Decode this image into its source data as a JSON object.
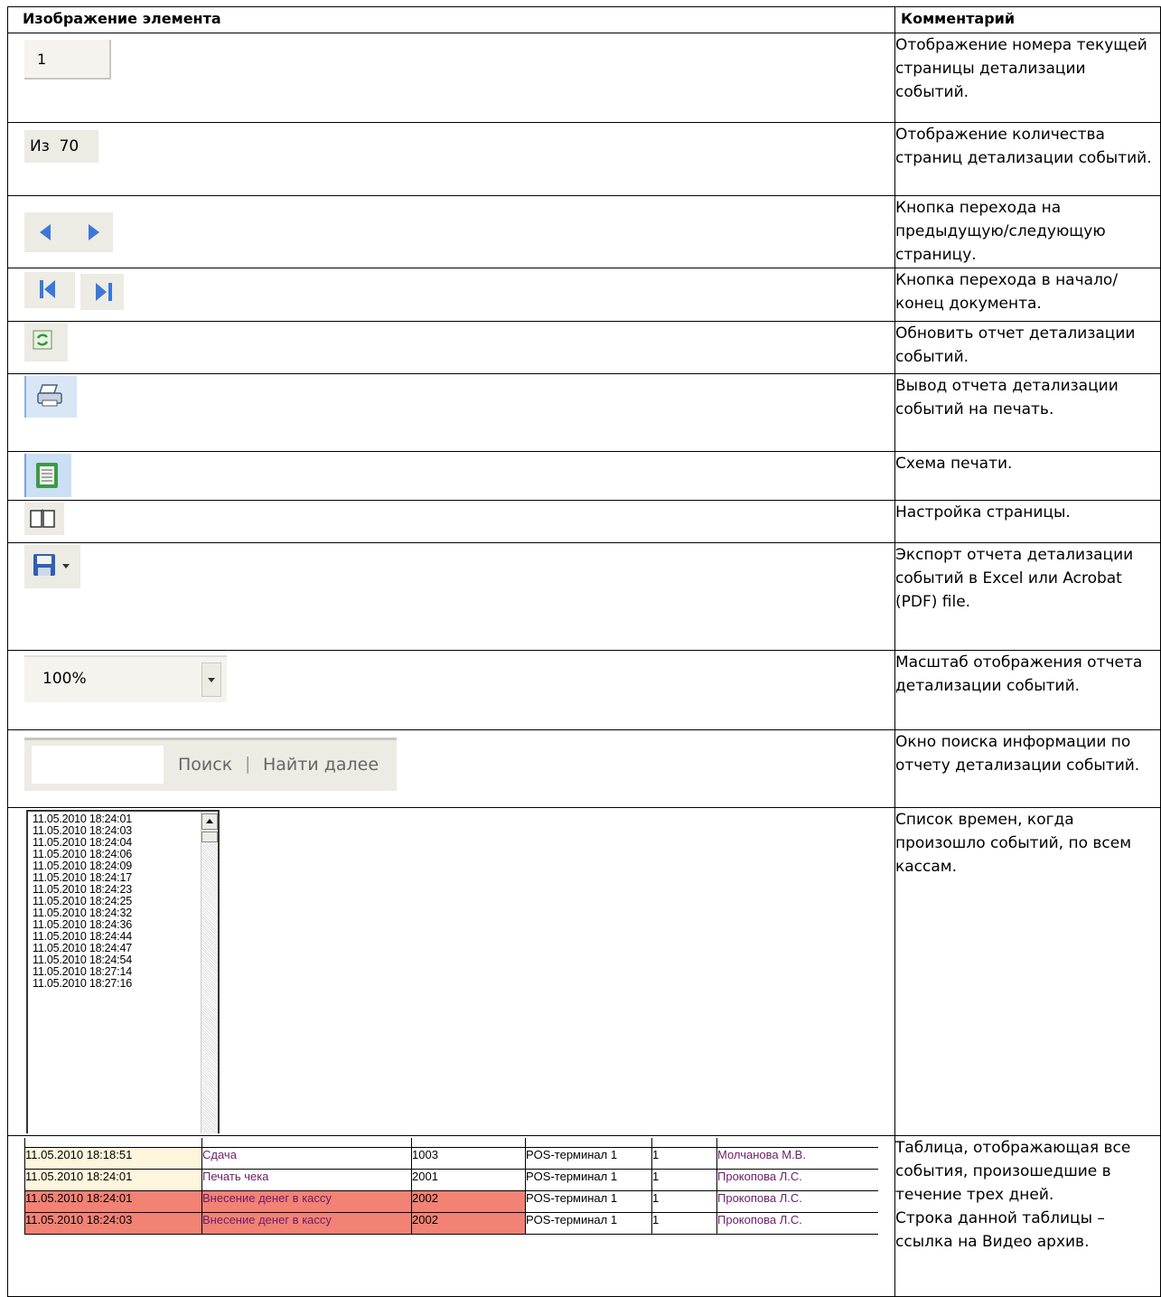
{
  "header": {
    "col_image": "Изображение элемента",
    "col_comment": "Комментарий"
  },
  "rows": [
    {
      "image": {
        "page_number": "1"
      },
      "comment": "Отображение номера текущей страницы детализации событий."
    },
    {
      "image": {
        "of_label": "Из",
        "of_value": "70"
      },
      "comment": "Отображение количества страниц  детализации событий."
    },
    {
      "image": {
        "icons": [
          "prev-page-icon",
          "next-page-icon"
        ]
      },
      "comment": "Кнопка перехода на предыдущую/следующую страницу."
    },
    {
      "image": {
        "icons": [
          "first-page-icon",
          "last-page-icon"
        ]
      },
      "comment": "Кнопка перехода в начало/конец документа."
    },
    {
      "image": {
        "icons": [
          "refresh-icon"
        ]
      },
      "comment": "Обновить отчет детализации событий."
    },
    {
      "image": {
        "icons": [
          "print-icon"
        ]
      },
      "comment": "Вывод отчета детализации событий на печать."
    },
    {
      "image": {
        "icons": [
          "print-layout-icon"
        ]
      },
      "comment": "Схема печати."
    },
    {
      "image": {
        "icons": [
          "page-setup-icon"
        ]
      },
      "comment": "Настройка страницы."
    },
    {
      "image": {
        "icons": [
          "save-export-icon",
          "dropdown-arrow-icon"
        ]
      },
      "comment": "Экспорт отчета детализации событий в Excel или Acrobat (PDF) file."
    },
    {
      "image": {
        "zoom_value": "100%"
      },
      "comment": "Масштаб отображения отчета детализации событий."
    },
    {
      "image": {
        "search_label": "Поиск",
        "separator": "|",
        "find_next_label": "Найти далее"
      },
      "comment": "Окно поиска информации по отчету детализации событий."
    },
    {
      "image": {
        "times": [
          "11.05.2010 18:24:01",
          "11.05.2010 18:24:03",
          "11.05.2010 18:24:04",
          "11.05.2010 18:24:06",
          "11.05.2010 18:24:09",
          "11.05.2010 18:24:17",
          "11.05.2010 18:24:23",
          "11.05.2010 18:24:25",
          "11.05.2010 18:24:32",
          "11.05.2010 18:24:36",
          "11.05.2010 18:24:44",
          "11.05.2010 18:24:47",
          "11.05.2010 18:24:54",
          "11.05.2010 18:27:14",
          "11.05.2010 18:27:16"
        ]
      },
      "comment": "Список времен, когда произошло событий, по всем кассам."
    },
    {
      "image": {
        "events": [
          {
            "date": "11.05.2010 18:18:51",
            "event": "Сдача",
            "code": "1003",
            "terminal": "POS-терминал 1",
            "num": "1",
            "cashier": "Молчанова М.В.",
            "highlight": false
          },
          {
            "date": "11.05.2010 18:24:01",
            "event": "Печать чека",
            "code": "2001",
            "terminal": "POS-терминал 1",
            "num": "1",
            "cashier": "Прокопова Л.С.",
            "highlight": false
          },
          {
            "date": "11.05.2010 18:24:01",
            "event": "Внесение денег в кассу",
            "code": "2002",
            "terminal": "POS-терминал 1",
            "num": "1",
            "cashier": "Прокопова Л.С.",
            "highlight": true
          },
          {
            "date": "11.05.2010 18:24:03",
            "event": "Внесение денег в кассу",
            "code": "2002",
            "terminal": "POS-терминал 1",
            "num": "1",
            "cashier": "Прокопова Л.С.",
            "highlight": true
          }
        ]
      },
      "comment": "Таблица, отображающая все события, произошедшие в течение трех дней.",
      "comment2": "Строка данной таблицы – ссылка на Видео архив."
    }
  ]
}
